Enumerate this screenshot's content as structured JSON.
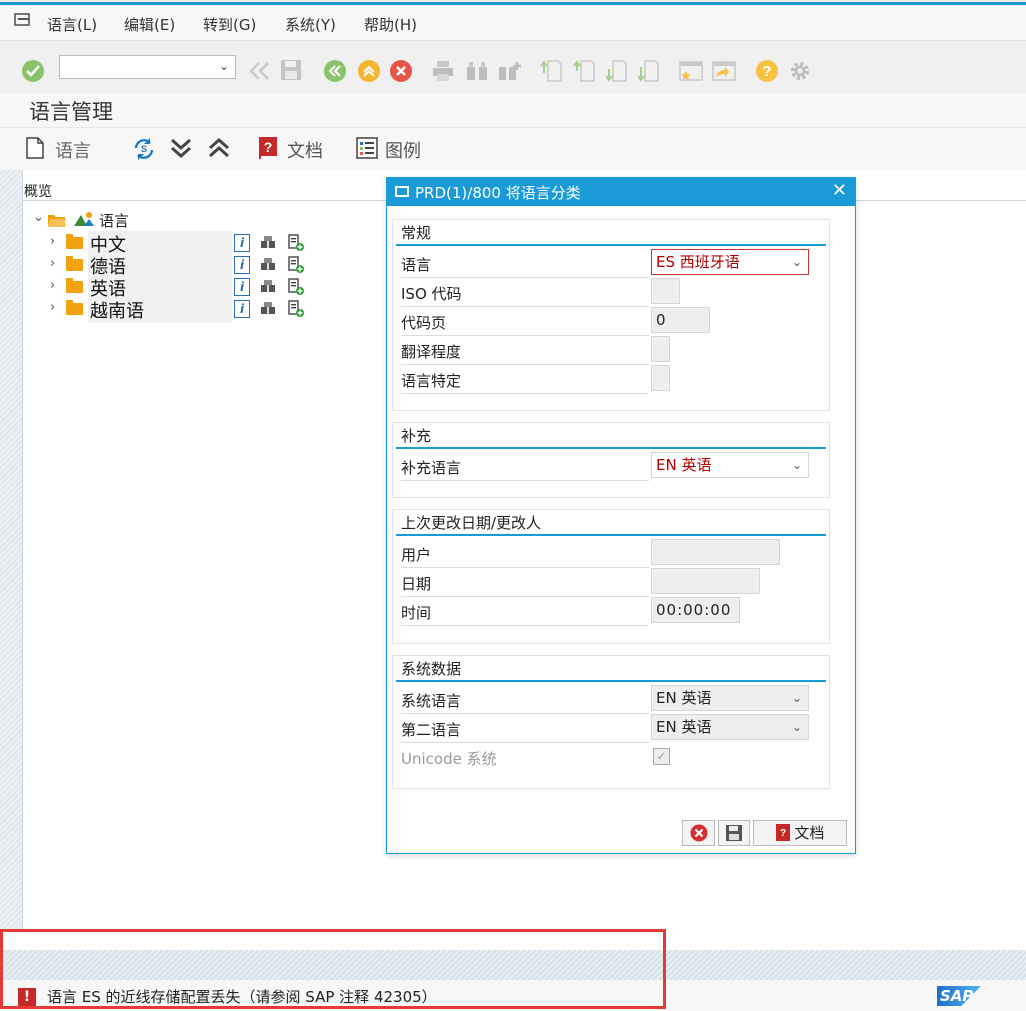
{
  "menu": [
    "语言(L)",
    "编辑(E)",
    "转到(G)",
    "系统(Y)",
    "帮助(H)"
  ],
  "page_title": "语言管理",
  "app_toolbar": {
    "new_language": "语言",
    "documentation": "文档",
    "legend": "图例"
  },
  "overview": {
    "title": "概览",
    "root": "语言",
    "items": [
      "中文",
      "德语",
      "英语",
      "越南语"
    ]
  },
  "dialog": {
    "title": "PRD(1)/800 将语言分类",
    "general": {
      "header": "常规",
      "language_label": "语言",
      "language_value": "ES 西班牙语",
      "iso_label": "ISO 代码",
      "iso_value": "",
      "codepage_label": "代码页",
      "codepage_value": "0",
      "translation_label": "翻译程度",
      "specific_label": "语言特定"
    },
    "supplement": {
      "header": "补充",
      "label": "补充语言",
      "value": "EN 英语"
    },
    "last_change": {
      "header": "上次更改日期/更改人",
      "user_label": "用户",
      "date_label": "日期",
      "time_label": "时间",
      "time_value": "00:00:00"
    },
    "system_data": {
      "header": "系统数据",
      "system_lang_label": "系统语言",
      "system_lang_value": "EN 英语",
      "second_lang_label": "第二语言",
      "second_lang_value": "EN 英语",
      "unicode_label": "Unicode 系统",
      "unicode_checked": "✓"
    },
    "buttons": {
      "doc": "文档"
    }
  },
  "status": {
    "message": "语言 ES 的近线存储配置丢失（请参阅 SAP 注释 42305）",
    "logo": "SAP"
  },
  "colors": {
    "accent": "#1a9ad6",
    "error": "#c62828",
    "folder": "#f2a20c"
  }
}
